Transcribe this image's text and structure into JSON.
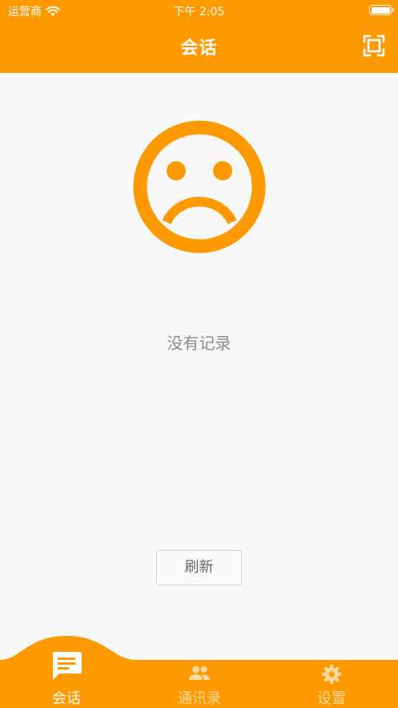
{
  "status_bar": {
    "carrier": "运营商",
    "time": "下午 2:05"
  },
  "nav": {
    "title": "会话",
    "scan_icon": "scan-icon"
  },
  "empty_state": {
    "icon": "sad-face-icon",
    "message": "没有记录",
    "refresh_label": "刷新"
  },
  "tabbar": {
    "items": [
      {
        "label": "会话",
        "icon": "chat-icon",
        "active": true
      },
      {
        "label": "通讯录",
        "icon": "contacts-icon",
        "active": false
      },
      {
        "label": "设置",
        "icon": "gear-icon",
        "active": false
      }
    ]
  },
  "colors": {
    "accent": "#ff9900",
    "inactive_tab": "#ffd9a0",
    "background": "#f8f8f8",
    "muted_text": "#8a8a8a"
  }
}
